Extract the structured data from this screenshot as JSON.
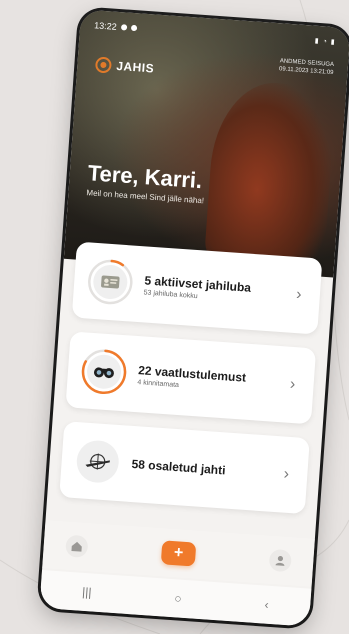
{
  "status_bar": {
    "time": "13:22",
    "right_icons": "signal-wifi-battery"
  },
  "header": {
    "data_update_label": "ANDMED SEISUGA",
    "data_update_time": "09.11.2023 13:21:09",
    "logo_text": "JAHIS",
    "greeting": "Tere, Karri.",
    "sub_greeting": "Meil on hea meel Sind jälle näha!"
  },
  "cards": [
    {
      "title": "5 aktiivset jahiluba",
      "subtitle": "53 jahiluba kokku",
      "icon": "id-card-icon",
      "progress": 0.09
    },
    {
      "title": "22 vaatlustulemust",
      "subtitle": "4 kinnitamata",
      "icon": "binoculars-icon",
      "progress": 0.82
    },
    {
      "title": "58 osaletud jahti",
      "subtitle": "",
      "icon": "rifle-scope-icon",
      "progress": 0
    }
  ],
  "bottom_nav": {
    "add_label": "+"
  },
  "system_nav": {
    "recent": "|||",
    "home": "○",
    "back": "‹"
  },
  "colors": {
    "accent": "#f07a2b",
    "ring_bg": "#e3e1df"
  }
}
